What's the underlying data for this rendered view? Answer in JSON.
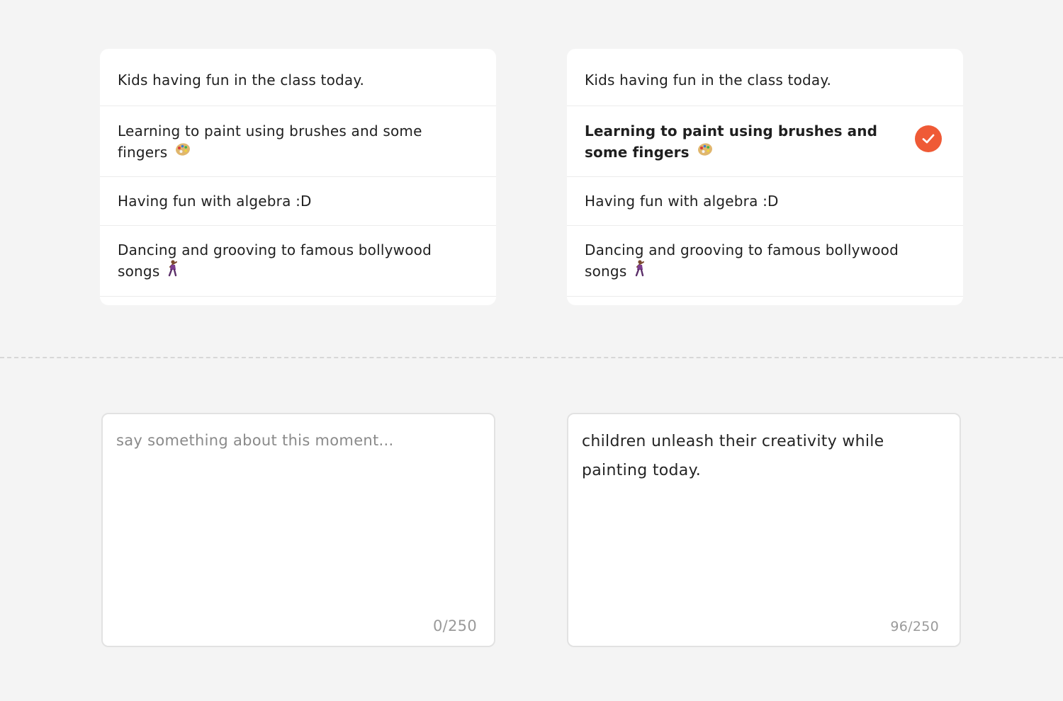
{
  "lists": {
    "left": {
      "items": [
        {
          "label": "Kids having fun in the class today."
        },
        {
          "label": "Learning to paint using brushes and some fingers"
        },
        {
          "label": "Having fun with algebra :D"
        },
        {
          "label": "Dancing and grooving to famous bollywood songs"
        }
      ]
    },
    "right": {
      "items": [
        {
          "label": "Kids having fun in the class today."
        },
        {
          "label": "Learning to paint using brushes and some fingers",
          "selected": true
        },
        {
          "label": "Having fun with algebra :D"
        },
        {
          "label": "Dancing and grooving to famous bollywood songs"
        }
      ]
    }
  },
  "comments": {
    "left": {
      "placeholder": "say something about this moment...",
      "value": "",
      "counter": "0/250"
    },
    "right": {
      "placeholder": "say something about this moment...",
      "value": "children unleash their creativity while painting today.",
      "counter": "96/250"
    }
  },
  "colors": {
    "accent": "#ef5a36",
    "background": "#f4f4f4",
    "card": "#ffffff"
  },
  "icons": {
    "paint": "artist-palette-icon",
    "dance": "dancer-icon",
    "selected": "check-circle-icon"
  }
}
